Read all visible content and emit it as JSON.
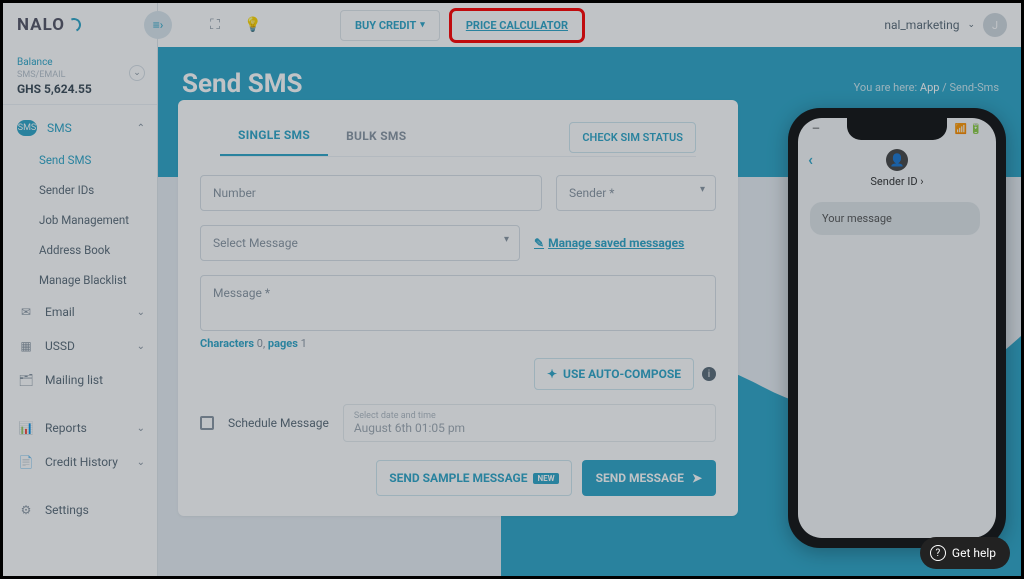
{
  "brand": "NALO",
  "balance": {
    "label": "Balance",
    "sub": "SMS/EMAIL",
    "amount": "GHS 5,624.55"
  },
  "nav": {
    "sms": {
      "label": "SMS",
      "badge": "SMS",
      "children": {
        "send": "Send SMS",
        "sender": "Sender IDs",
        "job": "Job Management",
        "address": "Address Book",
        "blacklist": "Manage Blacklist"
      }
    },
    "email": "Email",
    "ussd": "USSD",
    "mailing": "Mailing list",
    "reports": "Reports",
    "credit": "Credit History",
    "settings": "Settings"
  },
  "topbar": {
    "buy": "BUY CREDIT",
    "price": "PRICE CALCULATOR",
    "user": "nal_marketing",
    "avatar": "J"
  },
  "page": {
    "title": "Send SMS",
    "crumb_prefix": "You are here:",
    "crumb_app": "App",
    "crumb_page": "Send-Sms"
  },
  "tabs": {
    "single": "SINGLE SMS",
    "bulk": "BULK SMS",
    "sim": "CHECK SIM STATUS"
  },
  "form": {
    "number": "Number",
    "sender": "Sender *",
    "select_msg": "Select Message",
    "manage": "Manage saved messages",
    "message": "Message *",
    "chars_label": "Characters",
    "chars_val": "0,",
    "pages_label": "pages",
    "pages_val": "1",
    "auto": "USE AUTO-COMPOSE",
    "schedule": "Schedule Message",
    "sched_hint": "Select date and time",
    "sched_value": "August 6th 01:05 pm",
    "sample": "SEND SAMPLE MESSAGE",
    "send": "SEND MESSAGE"
  },
  "phone": {
    "sender": "Sender ID",
    "bubble": "Your message"
  },
  "help": "Get help"
}
